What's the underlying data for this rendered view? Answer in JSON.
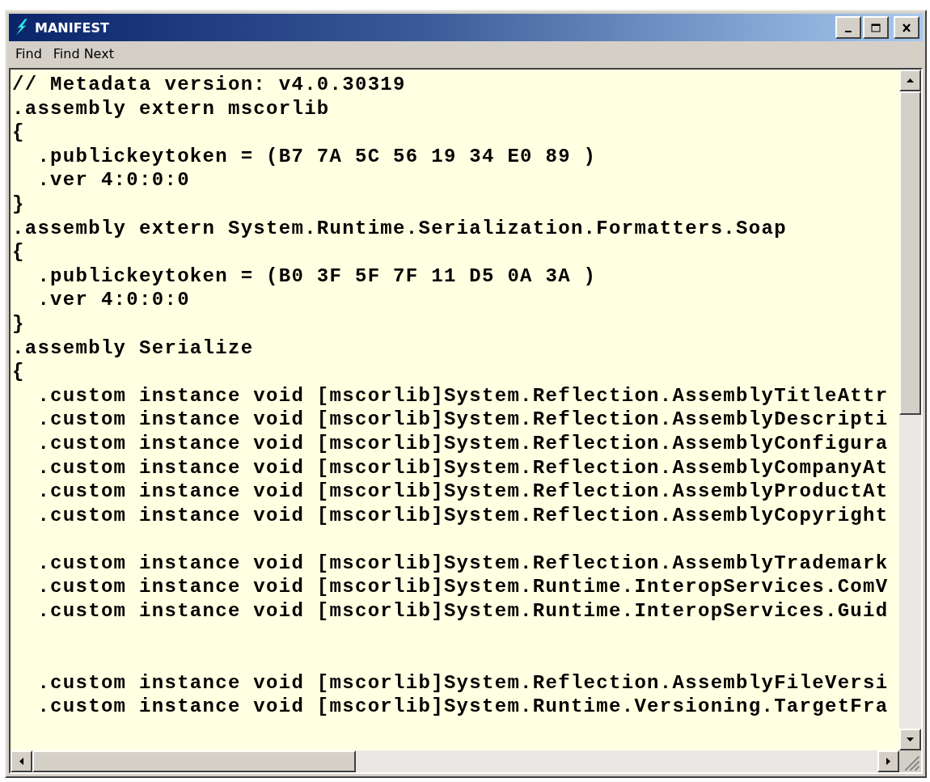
{
  "window": {
    "title": "MANIFEST"
  },
  "menu": [
    {
      "label": "Find"
    },
    {
      "label": "Find Next"
    }
  ],
  "lines": [
    {
      "kind": "text",
      "text": "// Metadata version: v4.0.30319"
    },
    {
      "kind": "text",
      "text": ".assembly extern mscorlib"
    },
    {
      "kind": "text",
      "text": "{"
    },
    {
      "kind": "text",
      "text": "  .publickeytoken = (B7 7A 5C 56 19 34 E0 89 )"
    },
    {
      "kind": "text",
      "text": "  .ver 4:0:0:0"
    },
    {
      "kind": "text",
      "text": "}"
    },
    {
      "kind": "text",
      "text": ".assembly extern System.Runtime.Serialization.Formatters.Soap"
    },
    {
      "kind": "text",
      "text": "{"
    },
    {
      "kind": "text",
      "text": "  .publickeytoken = (B0 3F 5F 7F 11 D5 0A 3A )"
    },
    {
      "kind": "text",
      "text": "  .ver 4:0:0:0"
    },
    {
      "kind": "text",
      "text": "}"
    },
    {
      "kind": "text",
      "text": ".assembly Serialize"
    },
    {
      "kind": "text",
      "text": "{"
    },
    {
      "kind": "text",
      "text": "  .custom instance void [mscorlib]System.Reflection.AssemblyTitleAttr"
    },
    {
      "kind": "text",
      "text": "  .custom instance void [mscorlib]System.Reflection.AssemblyDescripti"
    },
    {
      "kind": "text",
      "text": "  .custom instance void [mscorlib]System.Reflection.AssemblyConfigura"
    },
    {
      "kind": "text",
      "text": "  .custom instance void [mscorlib]System.Reflection.AssemblyCompanyAt"
    },
    {
      "kind": "text",
      "text": "  .custom instance void [mscorlib]System.Reflection.AssemblyProductAt"
    },
    {
      "kind": "text",
      "text": "  .custom instance void [mscorlib]System.Reflection.AssemblyCopyright"
    },
    {
      "kind": "blank"
    },
    {
      "kind": "text",
      "text": "  .custom instance void [mscorlib]System.Reflection.AssemblyTrademark"
    },
    {
      "kind": "text",
      "text": "  .custom instance void [mscorlib]System.Runtime.InteropServices.ComV"
    },
    {
      "kind": "text",
      "text": "  .custom instance void [mscorlib]System.Runtime.InteropServices.Guid"
    },
    {
      "kind": "blank"
    },
    {
      "kind": "blank"
    },
    {
      "kind": "text",
      "text": "  .custom instance void [mscorlib]System.Reflection.AssemblyFileVersi"
    },
    {
      "kind": "text",
      "text": "  .custom instance void [mscorlib]System.Runtime.Versioning.TargetFra"
    }
  ]
}
